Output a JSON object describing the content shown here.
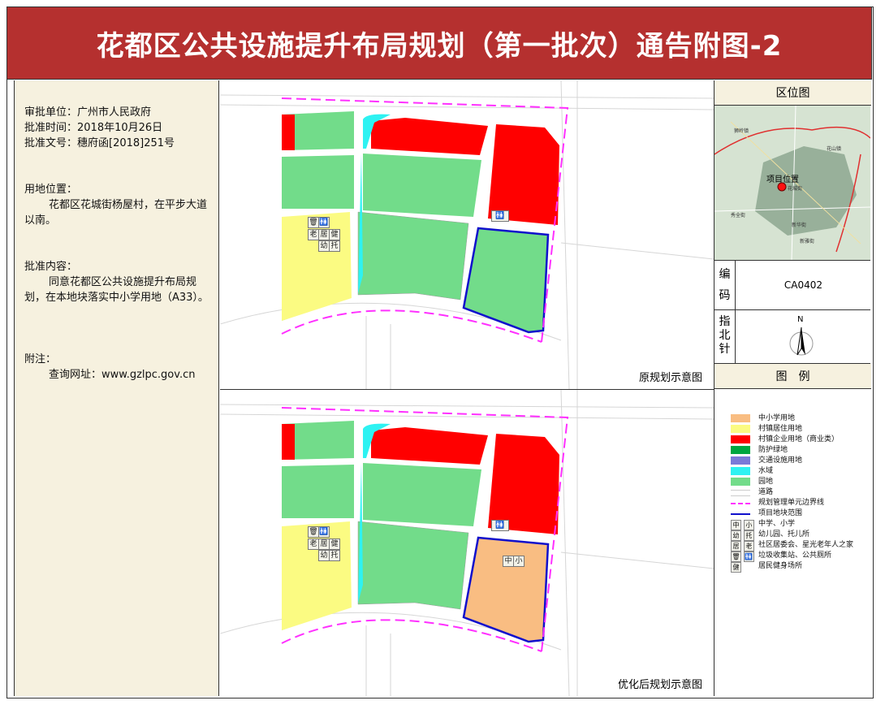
{
  "title": "花都区公共设施提升布局规划（第一批次）通告附图-2",
  "approval": {
    "unit": "审批单位：广州市人民政府",
    "time": "批准时间：2018年10月26日",
    "doc_no": "批准文号：穗府函[2018]251号",
    "location_label": "用地位置：",
    "location_text": "花都区花城街杨屋村，在平步大道以南。",
    "content_label": "批准内容：",
    "content_text": "同意花都区公共设施提升布局规划，在本地块落实中小学用地（A33）。",
    "note_label": "附注：",
    "note_text": "查询网址：www.gzlpc.gov.cn"
  },
  "maps": {
    "original_label": "原规划示意图",
    "optimized_label": "优化后规划示意图",
    "school_chars": [
      "中",
      "小"
    ],
    "facility_chars": [
      "老",
      "居",
      "健",
      "幼",
      "托"
    ]
  },
  "location_map": {
    "header": "区位图",
    "project_label": "项目位置",
    "places": [
      "狮岭镇",
      "花山镇",
      "花城街",
      "秀全街",
      "新华街",
      "新雅街"
    ]
  },
  "code": {
    "label": "编码",
    "value": "CA0402"
  },
  "north": {
    "label": "指北针",
    "letter": "N"
  },
  "legend": {
    "header": "图　例",
    "items": [
      {
        "label": "中小学用地",
        "color": "#f9bd82"
      },
      {
        "label": "村镇居住用地",
        "color": "#fbfb82"
      },
      {
        "label": "村镇企业用地（商业类）",
        "color": "#ff0000"
      },
      {
        "label": "防护绿地",
        "color": "#00a640"
      },
      {
        "label": "交通设施用地",
        "color": "#7a7ad8"
      },
      {
        "label": "水域",
        "color": "#2ef2f2"
      },
      {
        "label": "园地",
        "color": "#72dc8a"
      },
      {
        "label": "道路",
        "color": "#ffffff"
      },
      {
        "label": "规划管理单元边界线",
        "color": "#ff30ff"
      },
      {
        "label": "项目地块范围",
        "color": "#1010cc"
      },
      {
        "label": "中学、小学",
        "color": ""
      },
      {
        "label": "幼儿园、托儿所",
        "color": ""
      },
      {
        "label": "社区居委会、星光老年人之家",
        "color": ""
      },
      {
        "label": "垃圾收集站、公共厕所",
        "color": ""
      },
      {
        "label": "居民健身场所",
        "color": ""
      }
    ]
  }
}
